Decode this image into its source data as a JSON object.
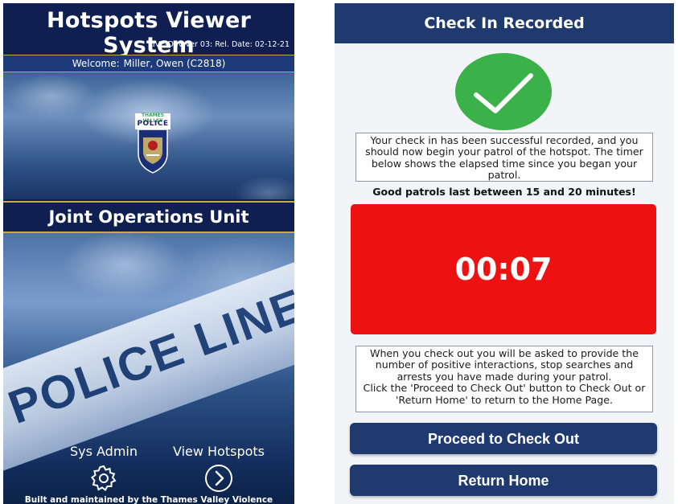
{
  "left_panel": {
    "app_title": "Hotspots Viewer System",
    "version": "LIVE-Dev Ver 03:  Rel. Date: 02-12-21",
    "welcome_label": "Welcome:",
    "welcome_user": "Miller, Owen (C2818)",
    "logo_text_top": "THAMES VALLEY",
    "logo_text_main": "POLICE",
    "unit_name": "Joint Operations Unit",
    "tape_text": "POLICE LINE DO NOT CROSS",
    "nav": [
      {
        "label": "Sys Admin",
        "icon": "gear-icon"
      },
      {
        "label": "View Hotspots",
        "icon": "chevron-right-circle-icon"
      }
    ],
    "footer": "Built and maintained by the Thames Valley Violence Reduction Unit"
  },
  "right_panel": {
    "header": "Check In Recorded",
    "status_icon": "checkmark-icon",
    "success_message": "Your check in has been successful recorded, and you should now begin your patrol of the hotspot. The timer below shows the elapsed time since you began your patrol.",
    "guidance": "Good patrols last between 15 and 20 minutes!",
    "timer": "00:07",
    "checkout_info_line1": "When you check out you will be asked to provide the number of positive interactions, stop searches and arrests you have made during your patrol.",
    "checkout_info_line2": "Click the 'Proceed to Check Out' button to Check Out or 'Return Home' to return to the Home Page.",
    "buttons": {
      "proceed": "Proceed to Check Out",
      "home": "Return Home"
    }
  },
  "colors": {
    "navy": "#0f1f52",
    "button_blue": "#1f3a6e",
    "gold_border": "#c9a949",
    "timer_red": "#ee1111",
    "check_green": "#3bb149"
  }
}
